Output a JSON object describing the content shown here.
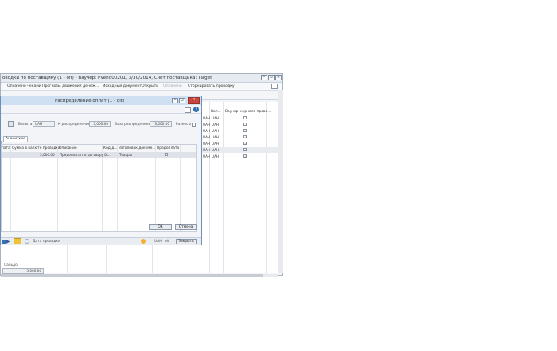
{
  "window": {
    "title": "оводки по поставщику (1 - oit) - Ваучер: PVend00201, 3/30/2014, Счет поставщика: Target",
    "min": "–",
    "restore": "▫",
    "close": "✕"
  },
  "toolbar": {
    "items": [
      "Оплачено чеками",
      "Прогнозы движения денеж...",
      "Исходный документ",
      "Открыть",
      "Оплачено",
      "Сторнировать проводку"
    ]
  },
  "grid": {
    "columns": [
      "Вал...",
      "Ваучер журнала прово..."
    ],
    "rows": [
      {
        "cur_code": "UAH",
        "currency": "UAH",
        "checked": false
      },
      {
        "cur_code": "UAH",
        "currency": "UAH",
        "checked": false
      },
      {
        "cur_code": "UAH",
        "currency": "UAH",
        "checked": false
      },
      {
        "cur_code": "UAH",
        "currency": "UAH",
        "checked": true
      },
      {
        "cur_code": "UAH",
        "currency": "UAH",
        "checked": true
      },
      {
        "cur_code": "UAH",
        "currency": "UAH",
        "checked": true
      },
      {
        "cur_code": "UAH",
        "currency": "UAH",
        "checked": true
      }
    ]
  },
  "footer": {
    "label": "Сальдо",
    "value": "3,000.00"
  },
  "dialog": {
    "title": "Распределение оплат (1 - oit)",
    "fields": {
      "currency_label": "Валюта:",
      "currency_value": "UAH",
      "to_distribute_label": "К распределению:",
      "to_distribute_value": "3,000.00",
      "distribution_base_label": "База распределения:",
      "distribution_base_value": "3,000.00",
      "differences_label": "Разносы"
    },
    "tab": "Аналитика",
    "columns": [
      "пата",
      "Сумма в валюте проводки",
      "Описание",
      "Код д...",
      "Заголовок докуме...",
      "Предоплата"
    ],
    "row": {
      "amount": "3,000.00",
      "description": "Предоплата по договору",
      "code": "Ot...",
      "header": "Товары",
      "prepayment": false
    },
    "buttons": {
      "ok": "OK",
      "cancel": "Отмена"
    },
    "status": {
      "posting_date": "Дата проводки",
      "currency": "UAH",
      "company": "oit",
      "close": "Закрыть"
    }
  }
}
